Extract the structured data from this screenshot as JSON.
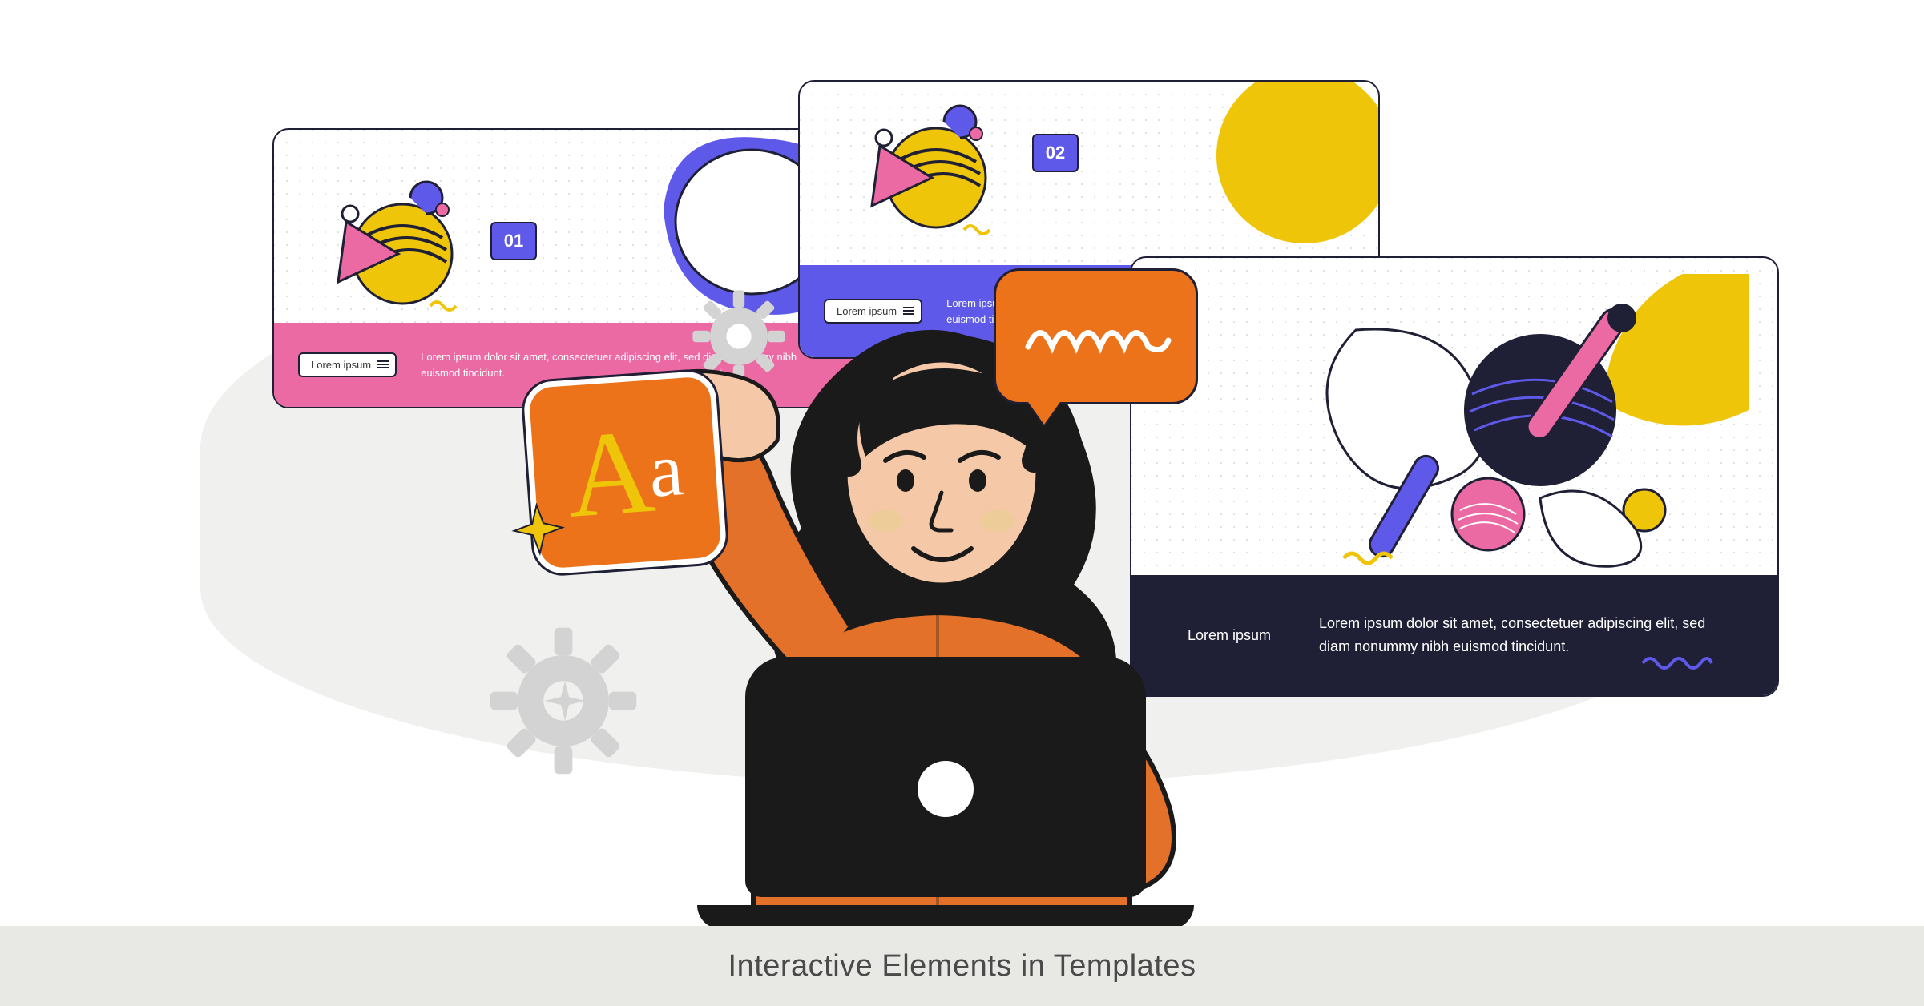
{
  "caption": "Interactive Elements in Templates",
  "cards": {
    "one": {
      "num": "01",
      "tag": "Lorem ipsum",
      "text": "Lorem ipsum dolor sit amet, consectetuer adipiscing elit, sed diam nonummy nibh euismod tincidunt."
    },
    "two": {
      "num": "02",
      "tag": "Lorem ipsum",
      "text": "Lorem ipsum dolor sit amet, consectetuer adipiscing elit, sed diam nonummy nibh euismod tincidunt."
    },
    "three": {
      "label": "Lorem ipsum",
      "text": "Lorem ipsum dolor sit amet, consectetuer adipiscing elit, sed diam nonummy nibh euismod tincidunt."
    }
  },
  "typography": {
    "big": "A",
    "small": "a"
  }
}
